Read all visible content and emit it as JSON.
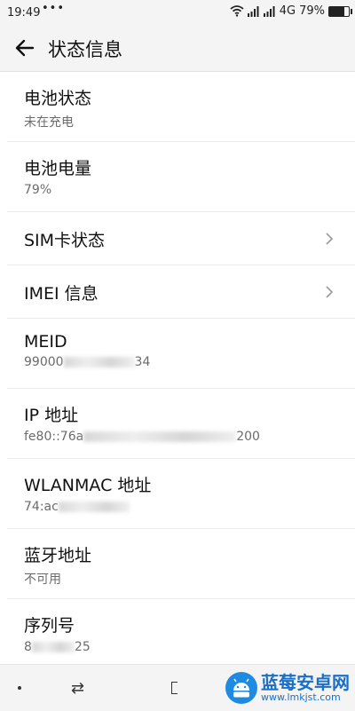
{
  "status_bar": {
    "time": "19:49",
    "dots": "•••",
    "network": "4G",
    "battery": "79%",
    "battery_level": 0.79
  },
  "app_bar": {
    "title": "状态信息"
  },
  "items": [
    {
      "title": "电池状态",
      "value": "未在充电"
    },
    {
      "title": "电池电量",
      "value": "79%"
    },
    {
      "title": "SIM卡状态"
    },
    {
      "title": "IMEI 信息"
    },
    {
      "title": "MEID",
      "value_prefix": "99000",
      "value_suffix": "34"
    },
    {
      "title": "IP 地址",
      "value_prefix": "fe80::76a",
      "value_suffix": "200"
    },
    {
      "title": "WLANMAC 地址",
      "value_prefix": "74:ac",
      "value_suffix": ""
    },
    {
      "title": "蓝牙地址",
      "value": "不可用"
    },
    {
      "title": "序列号",
      "value_prefix": "8",
      "value_suffix": "25"
    }
  ],
  "watermark": {
    "name": "蓝莓安卓网",
    "url": "www.lmkjst.com"
  }
}
